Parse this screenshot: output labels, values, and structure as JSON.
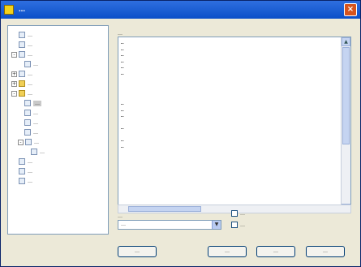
{
  "window": {
    "title": "…",
    "close_glyph": "×"
  },
  "tree": [
    {
      "label": "…",
      "icon": "doc-icon",
      "expander": ""
    },
    {
      "label": "…",
      "icon": "doc-icon",
      "expander": ""
    },
    {
      "label": "…",
      "icon": "doc-icon",
      "expander": "-"
    },
    {
      "label": "…",
      "icon": "doc-icon",
      "expander": ""
    },
    {
      "label": "…",
      "icon": "doc-icon",
      "expander": "+"
    },
    {
      "label": "…",
      "icon": "folder-icon",
      "expander": "+"
    },
    {
      "label": "…",
      "icon": "folder-icon",
      "expander": "-"
    },
    {
      "label": "…",
      "icon": "doc-icon",
      "expander": ""
    },
    {
      "label": "…",
      "icon": "doc-icon",
      "expander": ""
    },
    {
      "label": "…",
      "icon": "doc-icon",
      "expander": ""
    },
    {
      "label": "…",
      "icon": "doc-icon",
      "expander": ""
    },
    {
      "label": "…",
      "icon": "doc-icon",
      "expander": "-"
    },
    {
      "label": "…",
      "icon": "doc-icon",
      "expander": ""
    },
    {
      "label": "…",
      "icon": "doc-icon",
      "expander": ""
    },
    {
      "label": "…",
      "icon": "doc-icon",
      "expander": ""
    },
    {
      "label": "…",
      "icon": "doc-icon",
      "expander": ""
    }
  ],
  "editor": {
    "label": "…",
    "lines": [
      "…",
      "…",
      "…",
      "…",
      "…",
      "…",
      "",
      "",
      "",
      "",
      "…",
      "…",
      "…",
      "",
      "…",
      "",
      "…",
      "…"
    ]
  },
  "charset": {
    "label": "…",
    "value": "…",
    "dropdown_glyph": "▼"
  },
  "checkboxes": {
    "message_receipt": "…",
    "reading_confirmation": "…"
  },
  "buttons": {
    "macros": "…",
    "ok": "…",
    "cancel": "…",
    "help": "…"
  },
  "colors": {
    "titlebar": "#0b4fc8",
    "dialog": "#ece9d8",
    "selection": "#c9c9c9"
  }
}
